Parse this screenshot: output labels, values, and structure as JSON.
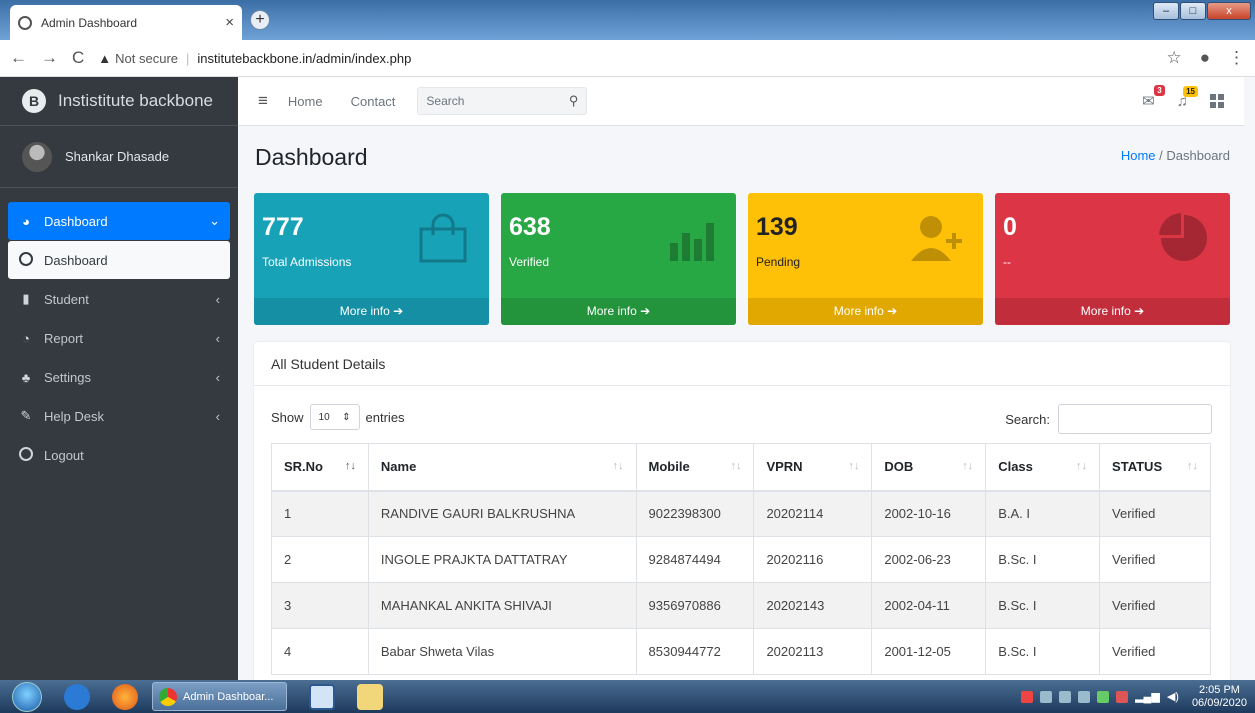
{
  "browser": {
    "tab_title": "Admin Dashboard",
    "tab_close": "×",
    "new_tab": "+",
    "not_secure": "Not secure",
    "url": "institutebackbone.in/admin/index.php"
  },
  "sidebar": {
    "brand": "Instistitute backbone",
    "brand_logo": "B",
    "user": "Shankar Dhasade",
    "items": [
      {
        "label": "Dashboard",
        "icon": "tachometer-icon",
        "active": true
      },
      {
        "label": "Dashboard",
        "icon": "circle-icon",
        "sub": true
      },
      {
        "label": "Student",
        "icon": "copy-icon"
      },
      {
        "label": "Report",
        "icon": "pie-chart-icon"
      },
      {
        "label": "Settings",
        "icon": "street-view-icon"
      },
      {
        "label": "Help Desk",
        "icon": "edit-icon"
      },
      {
        "label": "Logout",
        "icon": "circle-icon"
      }
    ]
  },
  "topnav": {
    "home": "Home",
    "contact": "Contact",
    "search_placeholder": "Search",
    "messages_badge": "3",
    "notifications_badge": "15"
  },
  "page": {
    "title": "Dashboard",
    "breadcrumb_home": "Home",
    "breadcrumb_sep": "/",
    "breadcrumb_current": "Dashboard"
  },
  "stats": [
    {
      "value": "777",
      "label": "Total Admissions",
      "more": "More info",
      "color": "#17a2b8",
      "icon": "shopping-bag-icon"
    },
    {
      "value": "638",
      "label": "Verified",
      "more": "More info",
      "color": "#28a745",
      "icon": "bar-chart-icon"
    },
    {
      "value": "139",
      "label": "Pending",
      "more": "More info",
      "color": "#ffc107",
      "icon": "user-plus-icon"
    },
    {
      "value": "0",
      "label": "--",
      "more": "More info",
      "color": "#dc3545",
      "icon": "pie-chart-icon"
    }
  ],
  "table_card": {
    "title": "All Student Details",
    "show": "Show",
    "entries_value": "10",
    "entries": "entries",
    "search_label": "Search:",
    "columns": [
      "SR.No",
      "Name",
      "Mobile",
      "VPRN",
      "DOB",
      "Class",
      "STATUS"
    ],
    "rows": [
      [
        "1",
        "RANDIVE GAURI BALKRUSHNA",
        "9022398300",
        "20202114",
        "2002-10-16",
        "B.A. I",
        "Verified"
      ],
      [
        "2",
        "INGOLE PRAJKTA DATTATRAY",
        "9284874494",
        "20202116",
        "2002-06-23",
        "B.Sc. I",
        "Verified"
      ],
      [
        "3",
        "MAHANKAL ANKITA SHIVAJI",
        "9356970886",
        "20202143",
        "2002-04-11",
        "B.Sc. I",
        "Verified"
      ],
      [
        "4",
        "Babar Shweta Vilas",
        "8530944772",
        "20202113",
        "2001-12-05",
        "B.Sc. I",
        "Verified"
      ]
    ]
  },
  "taskbar": {
    "app_label": "Admin Dashboar...",
    "time": "2:05 PM",
    "date": "06/09/2020"
  }
}
